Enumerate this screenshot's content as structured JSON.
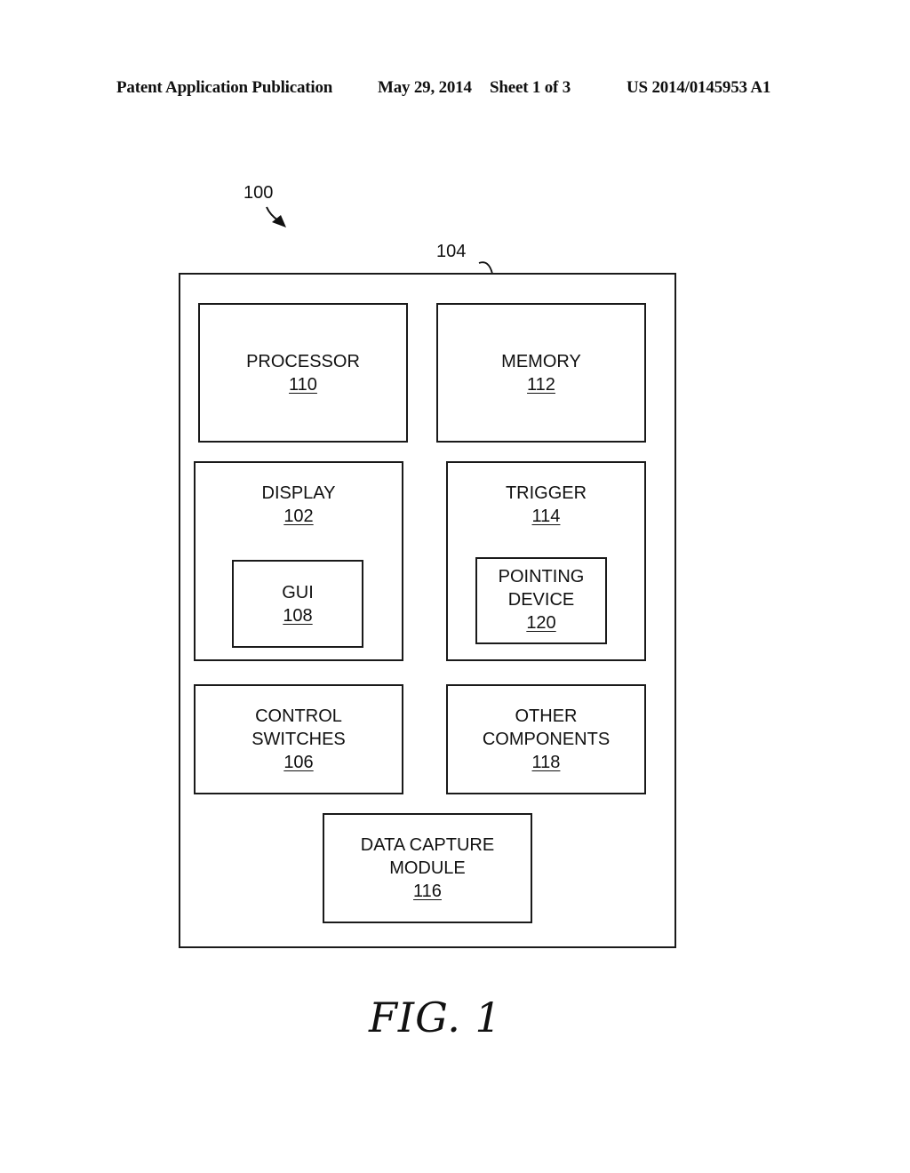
{
  "header": {
    "publication_type": "Patent Application Publication",
    "date": "May 29, 2014",
    "sheet": "Sheet 1 of 3",
    "pub_number": "US 2014/0145953 A1"
  },
  "diagram": {
    "system_ref": "100",
    "device_ref": "104",
    "blocks": {
      "processor": {
        "name": "PROCESSOR",
        "ref": "110"
      },
      "memory": {
        "name": "MEMORY",
        "ref": "112"
      },
      "display": {
        "name": "DISPLAY",
        "ref": "102"
      },
      "gui": {
        "name": "GUI",
        "ref": "108"
      },
      "trigger": {
        "name": "TRIGGER",
        "ref": "114"
      },
      "pointing_device": {
        "name_line1": "POINTING",
        "name_line2": "DEVICE",
        "ref": "120"
      },
      "control_switches": {
        "name_line1": "CONTROL",
        "name_line2": "SWITCHES",
        "ref": "106"
      },
      "other_components": {
        "name_line1": "OTHER",
        "name_line2": "COMPONENTS",
        "ref": "118"
      },
      "data_capture_module": {
        "name_line1": "DATA CAPTURE",
        "name_line2": "MODULE",
        "ref": "116"
      }
    }
  },
  "figure_label": "FIG. 1"
}
